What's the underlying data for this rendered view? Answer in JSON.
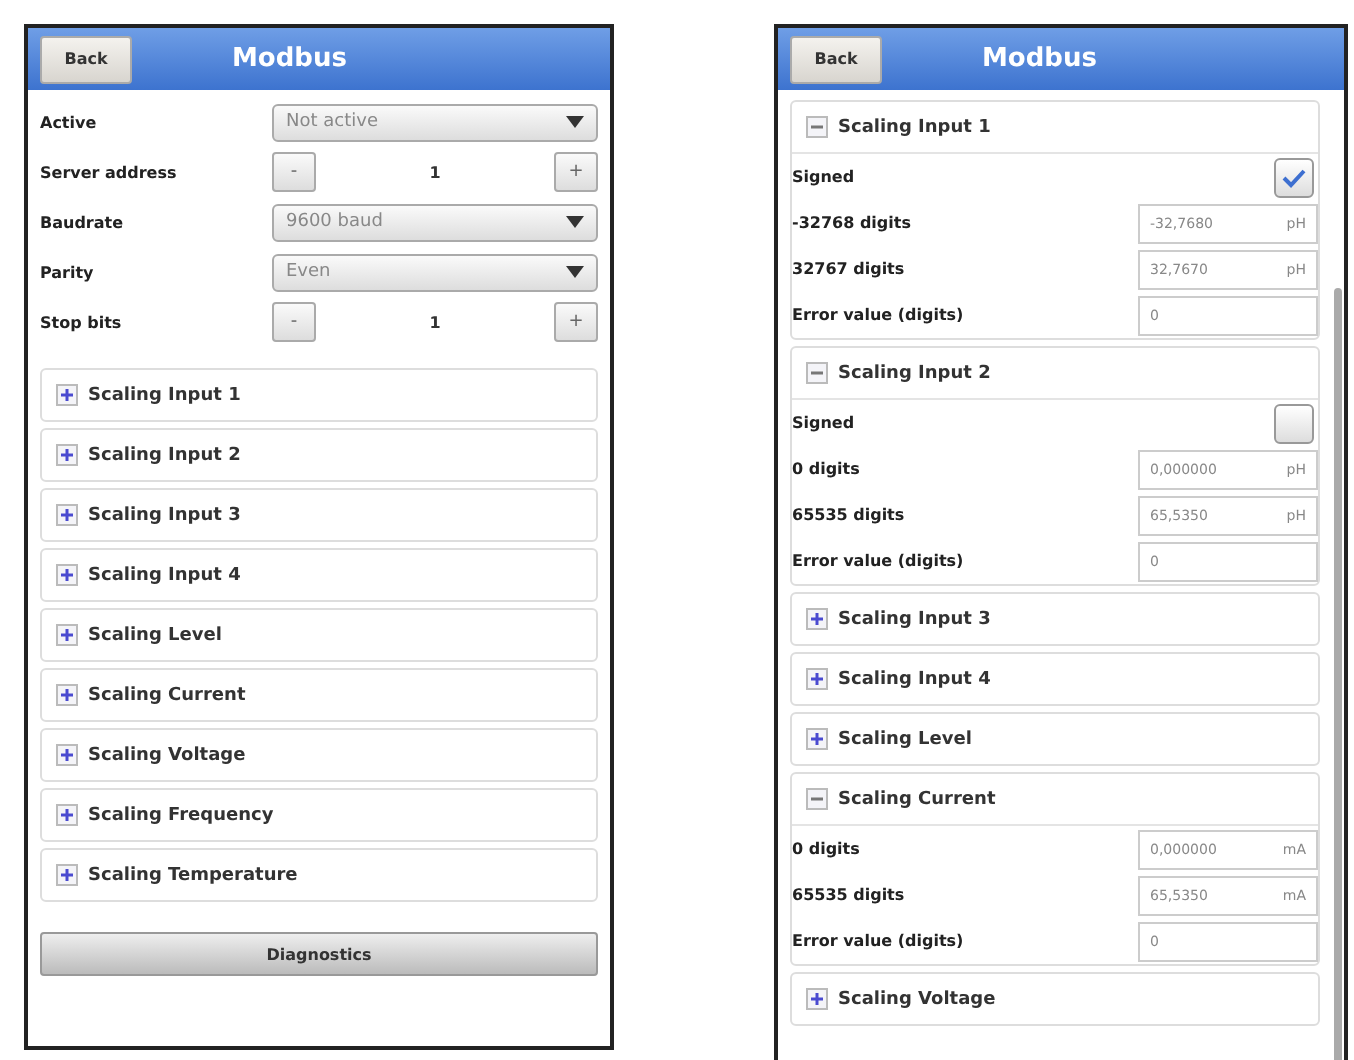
{
  "screens": [
    {
      "header": {
        "back": "Back",
        "title": "Modbus"
      },
      "fields": [
        {
          "kind": "select",
          "label": "Active",
          "value": "Not active"
        },
        {
          "kind": "stepper",
          "label": "Server address",
          "value": "1",
          "minus": "-",
          "plus": "+"
        },
        {
          "kind": "select",
          "label": "Baudrate",
          "value": "9600 baud"
        },
        {
          "kind": "select",
          "label": "Parity",
          "value": "Even"
        },
        {
          "kind": "stepper",
          "label": "Stop bits",
          "value": "1",
          "minus": "-",
          "plus": "+"
        }
      ],
      "sections": [
        {
          "title": "Scaling Input 1",
          "expanded": false
        },
        {
          "title": "Scaling Input 2",
          "expanded": false
        },
        {
          "title": "Scaling Input 3",
          "expanded": false
        },
        {
          "title": "Scaling Input 4",
          "expanded": false
        },
        {
          "title": "Scaling Level",
          "expanded": false
        },
        {
          "title": "Scaling Current",
          "expanded": false
        },
        {
          "title": "Scaling Voltage",
          "expanded": false
        },
        {
          "title": "Scaling Frequency",
          "expanded": false
        },
        {
          "title": "Scaling Temperature",
          "expanded": false
        }
      ],
      "button": "Diagnostics"
    },
    {
      "header": {
        "back": "Back",
        "title": "Modbus"
      },
      "sections": [
        {
          "title": "Scaling Input 1",
          "expanded": true,
          "rows": [
            {
              "kind": "checkbox",
              "label": "Signed",
              "checked": true
            },
            {
              "kind": "number",
              "label": "-32768 digits",
              "value": "-32,7680",
              "unit": "pH"
            },
            {
              "kind": "number",
              "label": "32767 digits",
              "value": "32,7670",
              "unit": "pH"
            },
            {
              "kind": "number",
              "label": "Error value (digits)",
              "value": "0"
            }
          ]
        },
        {
          "title": "Scaling Input 2",
          "expanded": true,
          "rows": [
            {
              "kind": "checkbox",
              "label": "Signed",
              "checked": false
            },
            {
              "kind": "number",
              "label": "0 digits",
              "value": "0,000000",
              "unit": "pH"
            },
            {
              "kind": "number",
              "label": "65535 digits",
              "value": "65,5350",
              "unit": "pH"
            },
            {
              "kind": "number",
              "label": "Error value (digits)",
              "value": "0"
            }
          ]
        },
        {
          "title": "Scaling Input 3",
          "expanded": false
        },
        {
          "title": "Scaling Input 4",
          "expanded": false
        },
        {
          "title": "Scaling Level",
          "expanded": false
        },
        {
          "title": "Scaling Current",
          "expanded": true,
          "rows": [
            {
              "kind": "number",
              "label": "0 digits",
              "value": "0,000000",
              "unit": "mA"
            },
            {
              "kind": "number",
              "label": "65535 digits",
              "value": "65,5350",
              "unit": "mA"
            },
            {
              "kind": "number",
              "label": "Error value (digits)",
              "value": "0"
            }
          ]
        },
        {
          "title": "Scaling Voltage",
          "expanded": false
        }
      ]
    }
  ]
}
